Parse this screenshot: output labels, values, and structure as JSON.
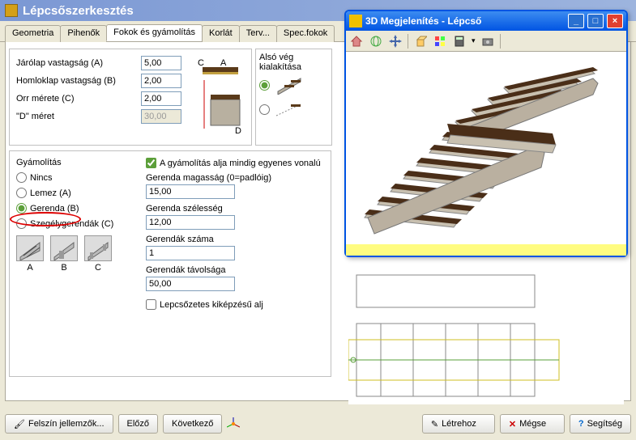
{
  "main": {
    "title": "Lépcsőszerkesztés"
  },
  "tabs": {
    "items": [
      {
        "label": "Geometria"
      },
      {
        "label": "Pihenők"
      },
      {
        "label": "Fokok és gyámolítás"
      },
      {
        "label": "Korlát"
      },
      {
        "label": "Terv..."
      },
      {
        "label": "Spec.fokok"
      }
    ],
    "active_index": 2
  },
  "tread_panel": {
    "rows": [
      {
        "label": "Járólap vastagság (A)",
        "value": "5,00",
        "enabled": true
      },
      {
        "label": "Homloklap vastagság (B)",
        "value": "2,00",
        "enabled": true
      },
      {
        "label": "Orr mérete (C)",
        "value": "2,00",
        "enabled": true
      },
      {
        "label": "\"D\" méret",
        "value": "30,00",
        "enabled": false
      }
    ]
  },
  "end_panel": {
    "title1": "Alsó vég",
    "title2": "kialakítása"
  },
  "support_panel": {
    "title": "Gyámolítás",
    "options": [
      {
        "label": "Nincs"
      },
      {
        "label": "Lemez (A)"
      },
      {
        "label": "Gerenda (B)"
      },
      {
        "label": "Szegélygerendák (C)"
      }
    ],
    "selected_index": 2,
    "checkbox": {
      "label": "A gyámolítás alja mindig egyenes vonalú",
      "checked": true
    },
    "fields": [
      {
        "label": "Gerenda magasság (0=padlóig)",
        "value": "15,00"
      },
      {
        "label": "Gerenda szélesség",
        "value": "12,00"
      },
      {
        "label": "Gerendák száma",
        "value": "1"
      },
      {
        "label": "Gerendák távolsága",
        "value": "50,00"
      }
    ],
    "stepped_checkbox": {
      "label": "Lepcsőzetes kiképzésű alj",
      "checked": false
    },
    "type_labels": [
      "A",
      "B",
      "C"
    ]
  },
  "buttons": {
    "surface": "Felszín jellemzők...",
    "prev": "Előző",
    "next": "Következő",
    "create": "Létrehoz",
    "cancel": "Mégse",
    "help": "Segítség"
  },
  "viewer": {
    "title": "3D Megjelenítés - Lépcső"
  }
}
